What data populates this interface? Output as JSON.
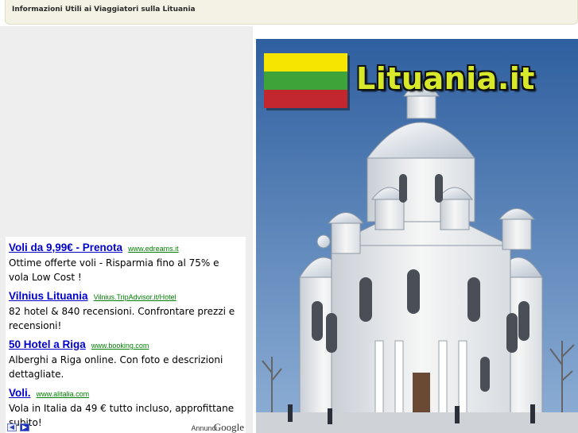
{
  "header": {
    "title": "Informazioni Utili ai Viaggiatori sulla Lituania"
  },
  "ads": [
    {
      "title": "Voli da 9,99€ - Prenota",
      "url": "www.edreams.it",
      "text": "Ottime offerte voli - Risparmia fino al 75% e vola Low Cost !"
    },
    {
      "title": "Vilnius Lituania",
      "url": "Vilnius.TripAdvisor.it/Hotel",
      "text": "82 hotel & 840 recensioni. Confrontare prezzi e recensioni!"
    },
    {
      "title": "50 Hotel a Riga",
      "url": "www.booking.com",
      "text": "Alberghi a Riga online. Con foto e descrizioni dettagliate."
    },
    {
      "title": "Voli.",
      "url": "www.alitalia.com",
      "text": "Vola in Italia da 49 € tutto incluso, approfittane subito!"
    }
  ],
  "ad_footer": {
    "prev_icon": "◀",
    "next_icon": "▶",
    "annunci": "Annunci",
    "google": "Google"
  },
  "hero": {
    "site_title": "Lituania.it",
    "flag_colors": [
      "#f5e500",
      "#3ea43a",
      "#c1272d"
    ],
    "sky_color": "#3f6fae",
    "church_color": "#f2f2f2"
  }
}
